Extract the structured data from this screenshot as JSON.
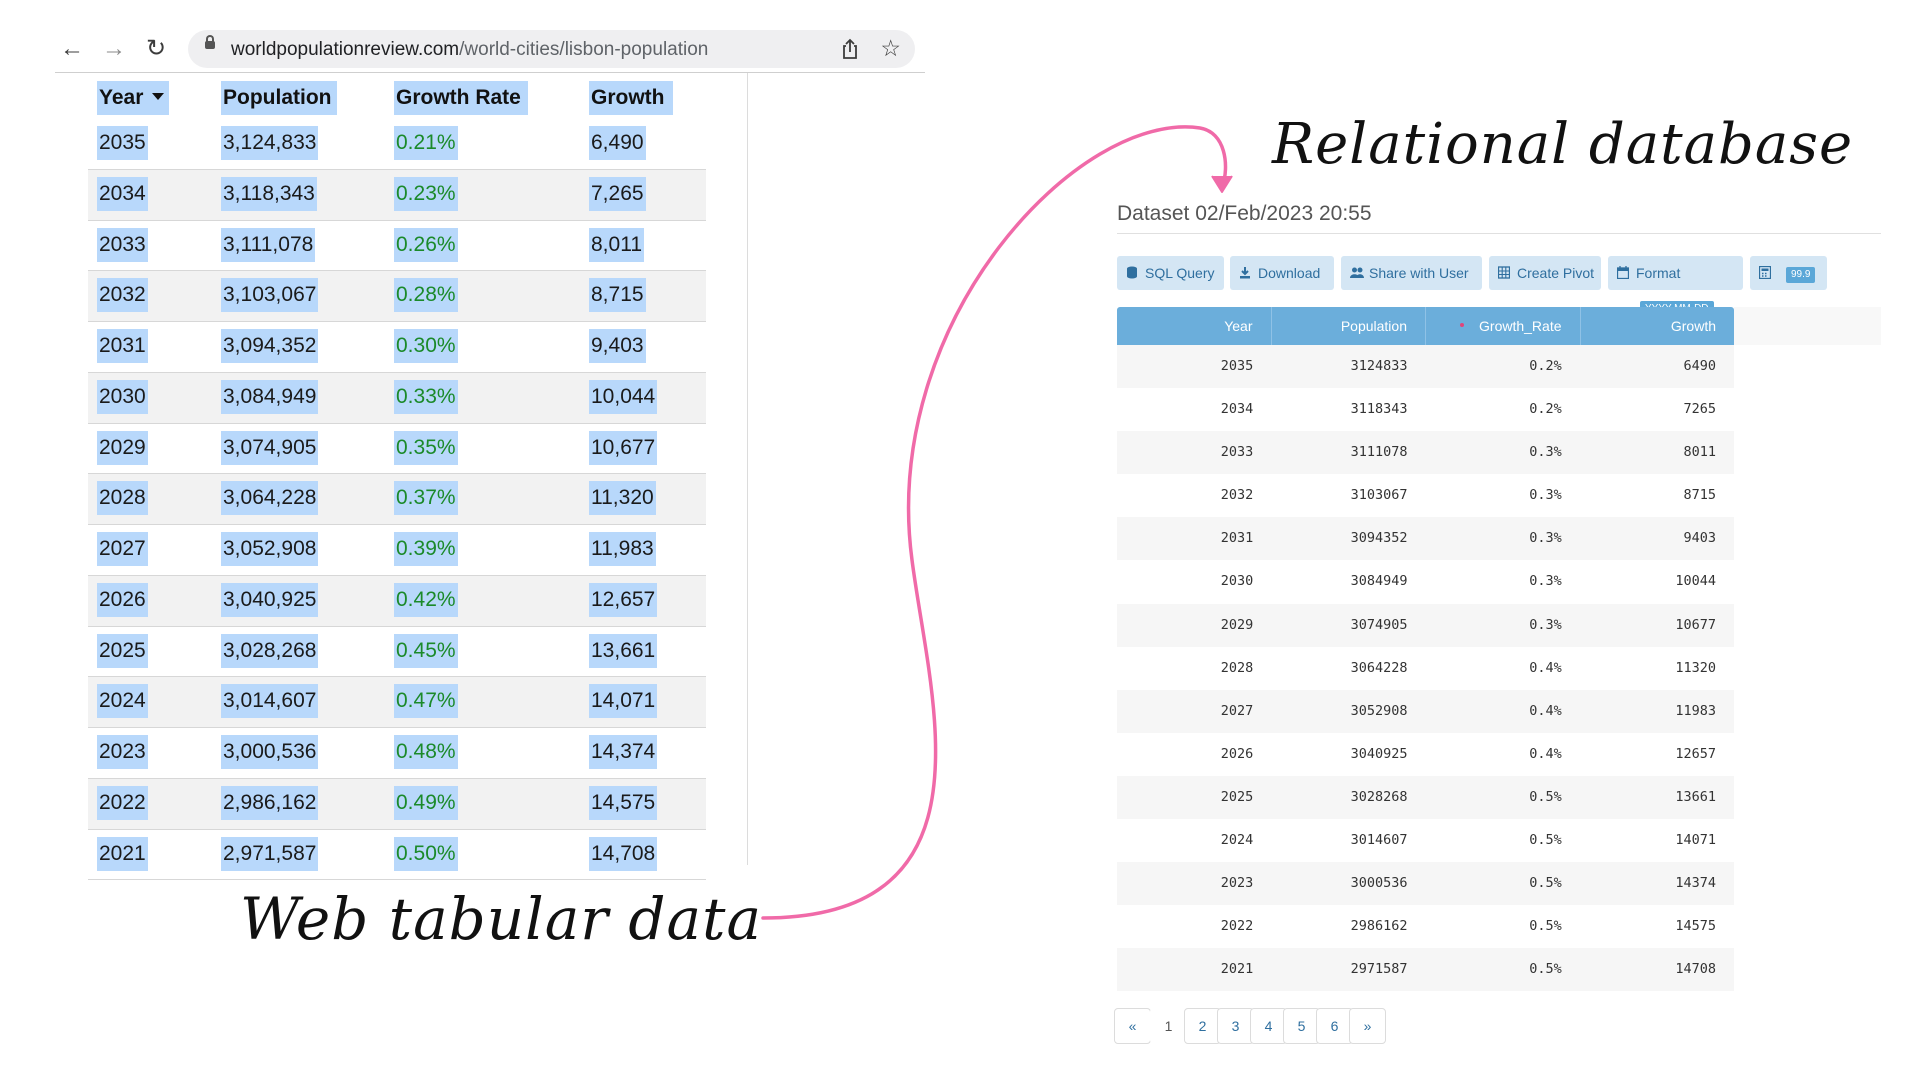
{
  "browser": {
    "url_host": "worldpopulationreview.com",
    "url_path": "/world-cities/lisbon-population",
    "icons": [
      "back-arrow-icon",
      "forward-arrow-icon",
      "reload-icon",
      "lock-icon",
      "share-icon",
      "star-icon"
    ]
  },
  "web_table": {
    "headers": {
      "year": "Year",
      "population": "Population",
      "rate": "Growth Rate",
      "growth": "Growth"
    },
    "rows": [
      {
        "year": "2035",
        "population": "3,124,833",
        "rate": "0.21%",
        "growth": "6,490"
      },
      {
        "year": "2034",
        "population": "3,118,343",
        "rate": "0.23%",
        "growth": "7,265"
      },
      {
        "year": "2033",
        "population": "3,111,078",
        "rate": "0.26%",
        "growth": "8,011"
      },
      {
        "year": "2032",
        "population": "3,103,067",
        "rate": "0.28%",
        "growth": "8,715"
      },
      {
        "year": "2031",
        "population": "3,094,352",
        "rate": "0.30%",
        "growth": "9,403"
      },
      {
        "year": "2030",
        "population": "3,084,949",
        "rate": "0.33%",
        "growth": "10,044"
      },
      {
        "year": "2029",
        "population": "3,074,905",
        "rate": "0.35%",
        "growth": "10,677"
      },
      {
        "year": "2028",
        "population": "3,064,228",
        "rate": "0.37%",
        "growth": "11,320"
      },
      {
        "year": "2027",
        "population": "3,052,908",
        "rate": "0.39%",
        "growth": "11,983"
      },
      {
        "year": "2026",
        "population": "3,040,925",
        "rate": "0.42%",
        "growth": "12,657"
      },
      {
        "year": "2025",
        "population": "3,028,268",
        "rate": "0.45%",
        "growth": "13,661"
      },
      {
        "year": "2024",
        "population": "3,014,607",
        "rate": "0.47%",
        "growth": "14,071"
      },
      {
        "year": "2023",
        "population": "3,000,536",
        "rate": "0.48%",
        "growth": "14,374"
      },
      {
        "year": "2022",
        "population": "2,986,162",
        "rate": "0.49%",
        "growth": "14,575"
      },
      {
        "year": "2021",
        "population": "2,971,587",
        "rate": "0.50%",
        "growth": "14,708"
      }
    ]
  },
  "labels": {
    "web": "Web tabular data",
    "db": "Relational database"
  },
  "db_panel": {
    "title": "Dataset 02/Feb/2023 20:55",
    "toolbar": {
      "sql": "SQL Query",
      "download": "Download",
      "share": "Share with User",
      "pivot": "Create Pivot",
      "format": "Format",
      "format_chip": "YYYY-MM-DD",
      "decimals_chip": "99.9"
    },
    "headers": {
      "year": "Year",
      "population": "Population",
      "rate": "Growth_Rate",
      "growth": "Growth"
    },
    "rows": [
      {
        "year": "2035",
        "population": "3124833",
        "rate": "0.2%",
        "growth": "6490"
      },
      {
        "year": "2034",
        "population": "3118343",
        "rate": "0.2%",
        "growth": "7265"
      },
      {
        "year": "2033",
        "population": "3111078",
        "rate": "0.3%",
        "growth": "8011"
      },
      {
        "year": "2032",
        "population": "3103067",
        "rate": "0.3%",
        "growth": "8715"
      },
      {
        "year": "2031",
        "population": "3094352",
        "rate": "0.3%",
        "growth": "9403"
      },
      {
        "year": "2030",
        "population": "3084949",
        "rate": "0.3%",
        "growth": "10044"
      },
      {
        "year": "2029",
        "population": "3074905",
        "rate": "0.3%",
        "growth": "10677"
      },
      {
        "year": "2028",
        "population": "3064228",
        "rate": "0.4%",
        "growth": "11320"
      },
      {
        "year": "2027",
        "population": "3052908",
        "rate": "0.4%",
        "growth": "11983"
      },
      {
        "year": "2026",
        "population": "3040925",
        "rate": "0.4%",
        "growth": "12657"
      },
      {
        "year": "2025",
        "population": "3028268",
        "rate": "0.5%",
        "growth": "13661"
      },
      {
        "year": "2024",
        "population": "3014607",
        "rate": "0.5%",
        "growth": "14071"
      },
      {
        "year": "2023",
        "population": "3000536",
        "rate": "0.5%",
        "growth": "14374"
      },
      {
        "year": "2022",
        "population": "2986162",
        "rate": "0.5%",
        "growth": "14575"
      },
      {
        "year": "2021",
        "population": "2971587",
        "rate": "0.5%",
        "growth": "14708"
      }
    ],
    "pager": [
      "«",
      "1",
      "2",
      "3",
      "4",
      "5",
      "6",
      "»"
    ],
    "current_page": "1"
  },
  "colors": {
    "cell_highlight": "#b8d8fb",
    "rate_green": "#1b8a2a",
    "db_header": "#6baedb",
    "db_button": "#d4e6f4",
    "arrow_pink": "#f06aa8"
  }
}
